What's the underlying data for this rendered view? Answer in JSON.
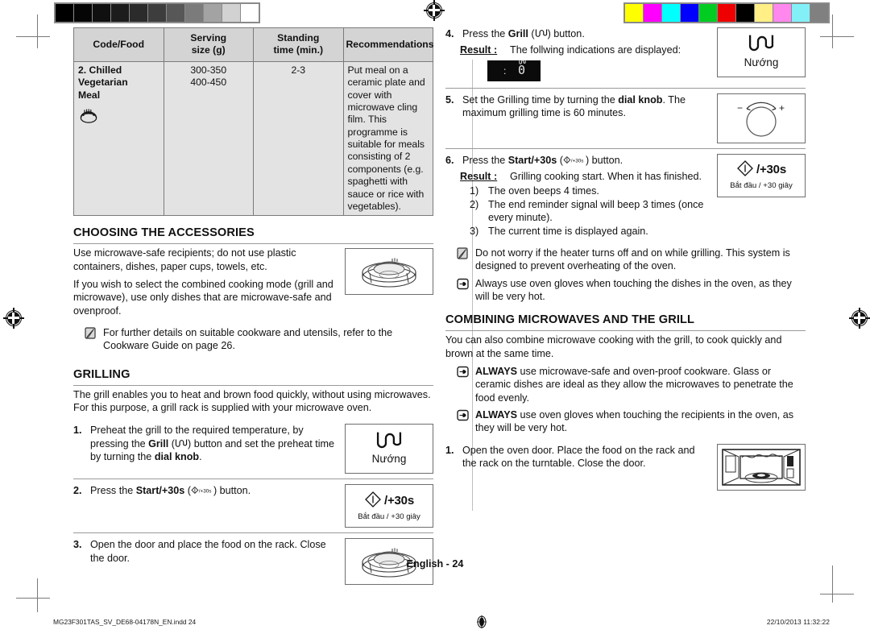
{
  "prepress": {
    "grayscale_swatches": [
      "#000000",
      "#050505",
      "#101010",
      "#1c1c1c",
      "#2b2b2b",
      "#3d3d3d",
      "#575757",
      "#7b7b7b",
      "#a3a3a3",
      "#d2d2d2",
      "#ffffff"
    ],
    "color_swatches": [
      "#ffff00",
      "#ff00ff",
      "#00ffff",
      "#0000ff",
      "#00cc22",
      "#ee0000",
      "#000000",
      "#ffef85",
      "#ff87ee",
      "#83f0f7",
      "#808080"
    ],
    "registration_icon": "registration-target-icon"
  },
  "table": {
    "headers": [
      "Code/Food",
      "Serving\nsize (g)",
      "Standing\ntime (min.)",
      "Recommendations"
    ],
    "header_code": "Code/Food",
    "header_serving_l1": "Serving",
    "header_serving_l2": "size (g)",
    "header_standing_l1": "Standing",
    "header_standing_l2": "time (min.)",
    "header_recommendations": "Recommendations",
    "rows": [
      {
        "code_l1": "2. Chilled",
        "code_l2": "Vegetarian",
        "code_l3": "Meal",
        "icon": "covered-dish-icon",
        "serving_1": "300-350",
        "serving_2": "400-450",
        "standing": "2-3",
        "recommendations": "Put meal on a ceramic plate and cover with microwave cling film. This programme is suitable for meals consisting of 2 components (e.g. spaghetti with sauce or rice with vegetables)."
      }
    ]
  },
  "left": {
    "accessories": {
      "title": "Choosing the accessories",
      "para1": "Use microwave-safe recipients; do not use plastic containers, dishes, paper cups, towels, etc.",
      "para2": "If you wish to select the combined cooking mode (grill and microwave), use only dishes that are microwave-safe and ovenproof.",
      "note": "For further details on suitable cookware and utensils, refer to the Cookware Guide on page 26.",
      "note_icon": "note-pencil-icon",
      "art_icon": "dish-on-rack-illustration"
    },
    "grilling": {
      "title": "Grilling",
      "intro": "The grill enables you to heat and brown food quickly, without using microwaves. For this purpose, a grill rack is supplied with your microwave oven.",
      "steps": [
        {
          "num": "1.",
          "text_a": "Preheat the grill to the required temperature, by pressing the ",
          "bold_a": "Grill",
          "text_b": " (",
          "glyph": "grill-element-icon",
          "text_c": ") button and set the preheat time by turning the ",
          "bold_b": "dial knob",
          "text_d": ".",
          "panel": {
            "type": "grill-button",
            "glyph": "grill-element-icon",
            "label": "Nướng"
          }
        },
        {
          "num": "2.",
          "text_a": "Press the ",
          "bold_a": "Start/+30s",
          "text_b": " (",
          "glyph": "start-plus30s-icon",
          "text_c": ") button.",
          "panel": {
            "type": "start-button",
            "glyph": "start-diamond-icon",
            "label_main": "/+30s",
            "label_vn": "Bắt đầu / +30 giây"
          }
        },
        {
          "num": "3.",
          "text_a": "Open the door and place the food on the rack. Close the door.",
          "panel": {
            "type": "illustration",
            "icon": "dish-on-rack-illustration"
          }
        }
      ]
    }
  },
  "right": {
    "steps": [
      {
        "num": "4.",
        "text_a": "Press the ",
        "bold_a": "Grill",
        "text_b": " (",
        "glyph": "grill-element-icon",
        "text_c": ") button.",
        "result_label": "Result :",
        "result_text": "The follwing indications are displayed:",
        "lcd": {
          "colon": ":",
          "digit": "0",
          "mini": "grill-indicator-icon"
        },
        "panel": {
          "type": "grill-button",
          "glyph": "grill-element-icon",
          "label": "Nướng"
        }
      },
      {
        "num": "5.",
        "text_a": "Set the Grilling time by turning the ",
        "bold_a": "dial knob",
        "text_b": ". The maximum grilling time is 60 minutes.",
        "panel": {
          "type": "dial",
          "icon": "dial-knob-icon",
          "minus": "−",
          "plus": "+"
        }
      },
      {
        "num": "6.",
        "text_a": "Press the ",
        "bold_a": "Start/+30s",
        "text_b": " (",
        "glyph": "start-plus30s-icon",
        "text_c": ") button.",
        "result_label": "Result :",
        "result_text": "Grilling cooking start. When it has finished.",
        "sublist": [
          {
            "num": "1)",
            "text": "The oven beeps 4 times."
          },
          {
            "num": "2)",
            "text": "The end reminder signal will beep 3 times (once every minute)."
          },
          {
            "num": "3)",
            "text": "The current time is displayed again."
          }
        ],
        "panel": {
          "type": "start-button",
          "glyph": "start-diamond-icon",
          "label_main": "/+30s",
          "label_vn": "Bắt đầu / +30 giây"
        }
      }
    ],
    "notes": [
      {
        "icon": "note-pencil-icon",
        "text": "Do not worry if the heater turns off and on while grilling. This system is designed to prevent overheating of the oven."
      },
      {
        "icon": "pointing-hand-icon",
        "text": "Always use oven gloves when touching the dishes in the oven, as they will be very hot."
      }
    ],
    "combining": {
      "title": "Combining microwaves and the grill",
      "intro": "You can also combine microwave cooking with the grill, to cook quickly and brown at the same time.",
      "notes": [
        {
          "icon": "pointing-hand-icon",
          "bold": "ALWAYS",
          "text": " use microwave-safe and oven-proof cookware. Glass or ceramic dishes are ideal as they allow the microwaves to penetrate the food evenly."
        },
        {
          "icon": "pointing-hand-icon",
          "bold": "ALWAYS",
          "text": " use oven gloves when touching the recipients in the oven, as they will be very hot."
        }
      ],
      "step": {
        "num": "1.",
        "text": "Open the oven door. Place the food on the rack and the rack on the turntable. Close the door.",
        "panel": {
          "type": "illustration",
          "icon": "open-oven-illustration"
        }
      }
    }
  },
  "footer": {
    "page_label": "English - 24",
    "file_name": "MG23F301TAS_SV_DE68-04178N_EN.indd   24",
    "registration_icon": "registration-target-icon",
    "date": "22/10/2013   11:32:22"
  }
}
